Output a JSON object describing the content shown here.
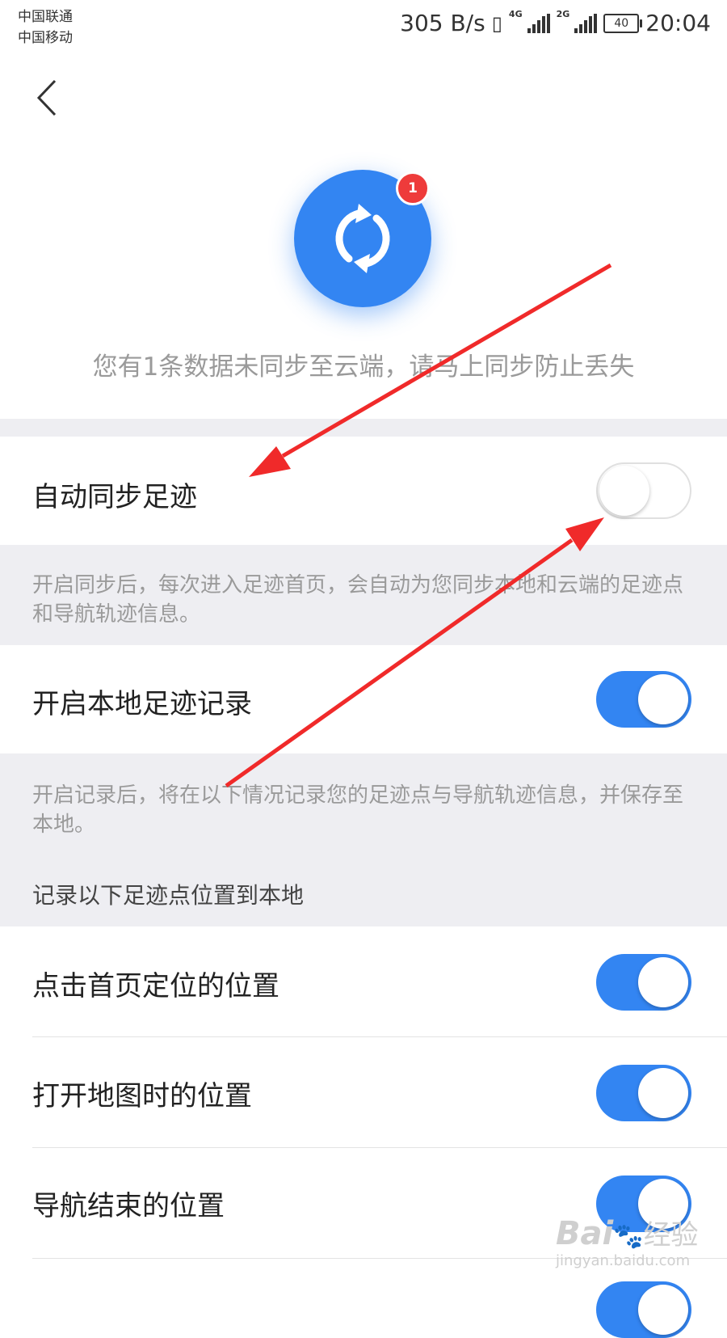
{
  "status_bar": {
    "carrier_1": "中国联通",
    "carrier_2": "中国移动",
    "net_speed": "305 B/s",
    "network_1": "4G",
    "network_2": "2G",
    "battery": "40",
    "time": "20:04",
    "vibrate_icon": "vibrate-icon"
  },
  "header": {
    "back_icon": "chevron-left-icon"
  },
  "sync": {
    "icon": "sync-icon",
    "badge_count": "1",
    "hint": "您有1条数据未同步至云端，请马上同步防止丢失"
  },
  "settings": {
    "auto_sync": {
      "label": "自动同步足迹",
      "enabled": false
    },
    "auto_sync_desc": "开启同步后，每次进入足迹首页，会自动为您同步本地和云端的足迹点和导航轨迹信息。",
    "local_record": {
      "label": "开启本地足迹记录",
      "enabled": true
    },
    "local_record_desc": "开启记录后，将在以下情况记录您的足迹点与导航轨迹信息，并保存至本地。",
    "section_title": "记录以下足迹点位置到本地",
    "locations": [
      {
        "label": "点击首页定位的位置",
        "enabled": true
      },
      {
        "label": "打开地图时的位置",
        "enabled": true
      },
      {
        "label": "导航结束的位置",
        "enabled": true
      }
    ]
  },
  "annotations": {
    "arrow_color": "#f02a2a"
  },
  "watermark": {
    "brand": "Bai",
    "brand_cn": "经验",
    "url": "jingyan.baidu.com"
  },
  "colors": {
    "accent": "#3385f2",
    "badge": "#ee3b3b",
    "background_gray": "#eeeef2"
  }
}
